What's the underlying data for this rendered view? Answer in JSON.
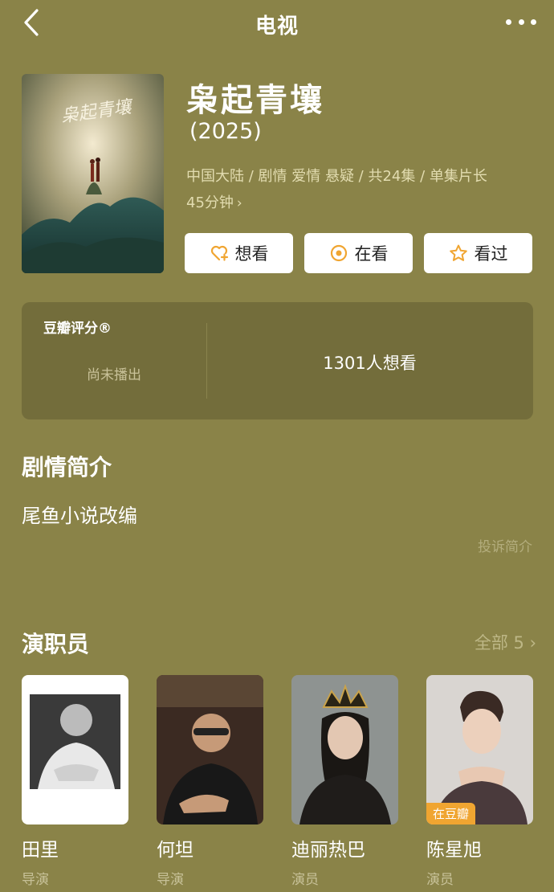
{
  "nav": {
    "title": "电视"
  },
  "show": {
    "title": "枭起青壤",
    "year": "(2025)",
    "meta_line1": "中国大陆 / 剧情 爱情 悬疑 / 共24集 / 单集片长",
    "meta_line2": "45分钟",
    "poster_calligraphy": "枭起青壤"
  },
  "actions": {
    "want_label": "想看",
    "watching_label": "在看",
    "watched_label": "看过"
  },
  "rating": {
    "label": "豆瓣评分®",
    "status": "尚未播出",
    "want_count": "1301人想看"
  },
  "synopsis": {
    "title": "剧情简介",
    "text": "尾鱼小说改编",
    "report_label": "投诉简介"
  },
  "cast": {
    "title": "演职员",
    "all_label": "全部 5",
    "members": [
      {
        "name": "田里",
        "role": "导演"
      },
      {
        "name": "何坦",
        "role": "导演"
      },
      {
        "name": "迪丽热巴",
        "role": "演员"
      },
      {
        "name": "陈星旭",
        "role": "演员",
        "badge": "在豆瓣"
      }
    ]
  },
  "colors": {
    "background": "#8a8348",
    "card": "#736d3b",
    "accent_orange": "#f0a531"
  }
}
